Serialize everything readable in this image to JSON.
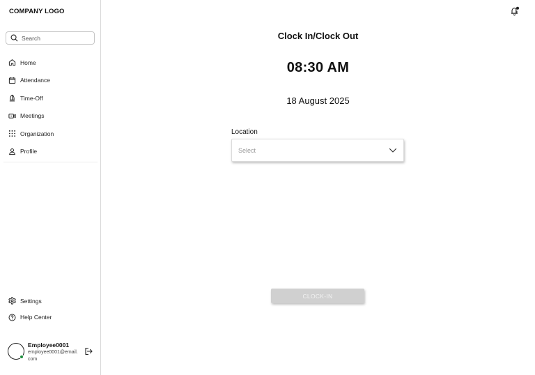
{
  "sidebar": {
    "logo": "COMPANY LOGO",
    "search": {
      "placeholder": "Search",
      "icon": "search-icon"
    },
    "nav_items": [
      {
        "label": "Home",
        "icon": "home-icon"
      },
      {
        "label": "Attendance",
        "icon": "calendar-icon"
      },
      {
        "label": "Time-Off",
        "icon": "beach-umbrella-icon"
      },
      {
        "label": "Meetings",
        "icon": "video-camera-icon"
      },
      {
        "label": "Organization",
        "icon": "grid-dots-icon"
      },
      {
        "label": "Profile",
        "icon": "user-icon"
      }
    ],
    "bottom_items": [
      {
        "label": "Settings",
        "icon": "gear-icon"
      },
      {
        "label": "Help Center",
        "icon": "help-circle-icon"
      }
    ],
    "profile": {
      "name": "Employee0001",
      "email": "employee0001@email.com",
      "status_color": "#1e8e3e"
    }
  },
  "main": {
    "title": "Clock In/Clock Out",
    "time": "08:30 AM",
    "date": "18 August 2025",
    "location": {
      "label": "Location",
      "selected": "Select"
    },
    "clock_button": "CLOCK-IN"
  },
  "colors": {
    "button_disabled_bg": "#d0d0d0",
    "online": "#1e8e3e"
  }
}
